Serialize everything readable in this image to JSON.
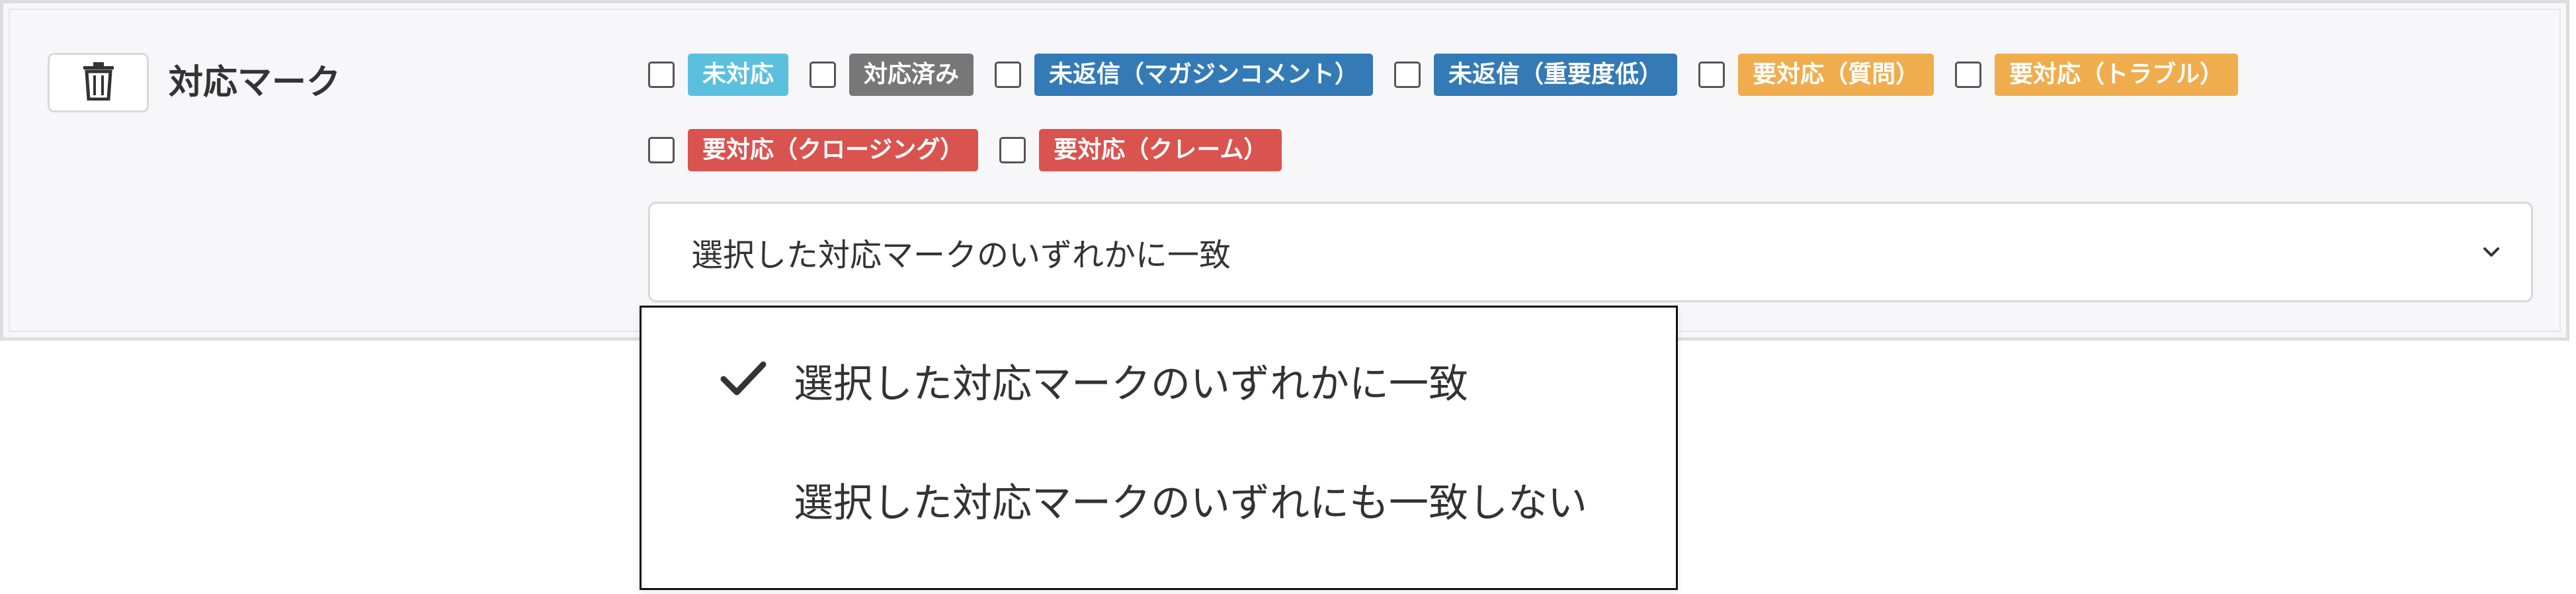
{
  "filter": {
    "label": "対応マーク",
    "delete_icon": "trash-icon",
    "marks_row1": [
      {
        "label": "未対応",
        "color": "#5bc0de",
        "checked": false
      },
      {
        "label": "対応済み",
        "color": "#777777",
        "checked": false
      },
      {
        "label": "未返信（マガジンコメント）",
        "color": "#337ab7",
        "checked": false
      },
      {
        "label": "未返信（重要度低）",
        "color": "#337ab7",
        "checked": false
      },
      {
        "label": "要対応（質問）",
        "color": "#f0ad4e",
        "checked": false
      },
      {
        "label": "要対応（トラブル）",
        "color": "#f0ad4e",
        "checked": false
      }
    ],
    "marks_row2": [
      {
        "label": "要対応（クロージング）",
        "color": "#d9534f",
        "checked": false
      },
      {
        "label": "要対応（クレーム）",
        "color": "#d9534f",
        "checked": false
      }
    ],
    "match_select": {
      "selected": "選択した対応マークのいずれかに一致",
      "chevron_icon": "chevron-down-icon",
      "options": [
        {
          "label": "選択した対応マークのいずれかに一致",
          "selected": true,
          "check_icon": "check-icon"
        },
        {
          "label": "選択した対応マークのいずれにも一致しない",
          "selected": false
        }
      ]
    }
  }
}
